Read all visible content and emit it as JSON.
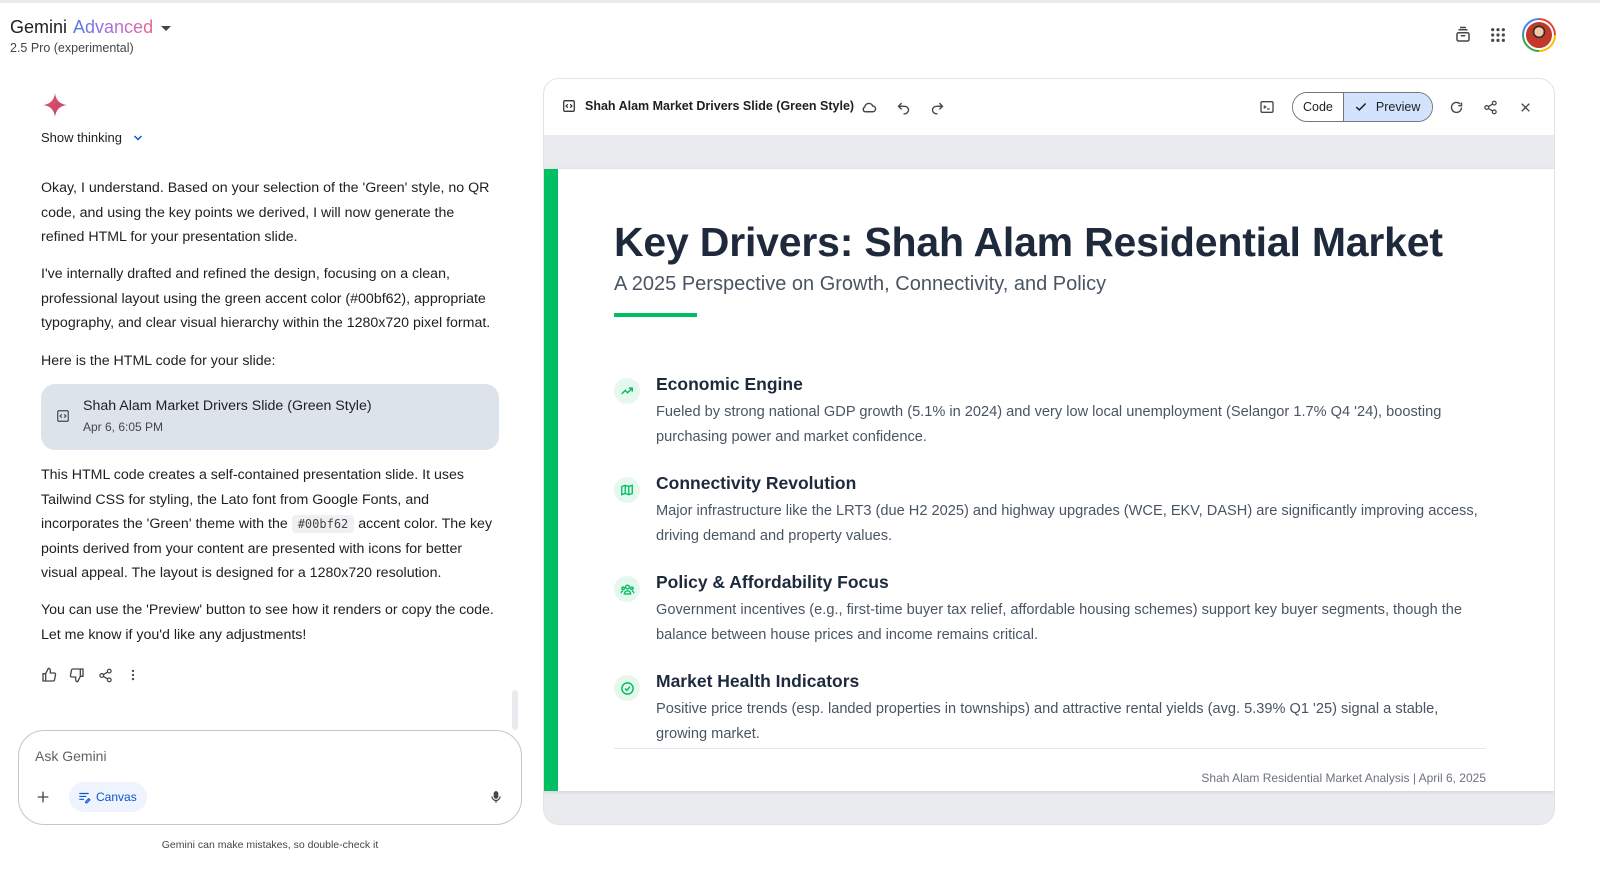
{
  "header": {
    "brand_name": "Gemini",
    "brand_tier": "Advanced",
    "model": "2.5 Pro (experimental)"
  },
  "chat": {
    "show_thinking": "Show thinking",
    "paragraphs": [
      "Okay, I understand. Based on your selection of the 'Green' style, no QR code, and using the key points we derived, I will now generate the refined HTML for your presentation slide.",
      "I've internally drafted and refined the design, focusing on a clean, professional layout using the green accent color (#00bf62), appropriate typography, and clear visual hierarchy within the 1280x720 pixel format.",
      "Here is the HTML code for your slide:"
    ],
    "artifact": {
      "title": "Shah Alam Market Drivers Slide (Green Style)",
      "date": "Apr 6, 6:05 PM"
    },
    "after_1_pre": "This HTML code creates a self-contained presentation slide. It uses Tailwind CSS for styling, the Lato font from Google Fonts, and incorporates the 'Green' theme with the",
    "after_1_code": "#00bf62",
    "after_1_post": "accent color. The key points derived from your content are presented with icons for better visual appeal. The layout is designed for a 1280x720 resolution.",
    "after_2": "You can use the 'Preview' button to see how it renders or copy the code. Let me know if you'd like any adjustments!",
    "input_placeholder": "Ask Gemini",
    "canvas_chip": "Canvas",
    "disclaimer": "Gemini can make mistakes, so double-check it"
  },
  "canvas": {
    "title": "Shah Alam Market Drivers Slide (Green Style)",
    "code_label": "Code",
    "preview_label": "Preview",
    "slide": {
      "accent_color": "#00bf62",
      "title": "Key Drivers: Shah Alam Residential Market",
      "subtitle": "A 2025 Perspective on Growth, Connectivity, and Policy",
      "points": [
        {
          "icon": "trending-up-icon",
          "title": "Economic Engine",
          "body": "Fueled by strong national GDP growth (5.1% in 2024) and very low local unemployment (Selangor 1.7% Q4 '24), boosting purchasing power and market confidence."
        },
        {
          "icon": "map-icon",
          "title": "Connectivity Revolution",
          "body": "Major infrastructure like the LRT3 (due H2 2025) and highway upgrades (WCE, EKV, DASH) are significantly improving access, driving demand and property values."
        },
        {
          "icon": "people-icon",
          "title": "Policy & Affordability Focus",
          "body": "Government incentives (e.g., first-time buyer tax relief, affordable housing schemes) support key buyer segments, though the balance between house prices and income remains critical."
        },
        {
          "icon": "check-circle-icon",
          "title": "Market Health Indicators",
          "body": "Positive price trends (esp. landed properties in townships) and attractive rental yields (avg. 5.39% Q1 '25) signal a stable, growing market."
        }
      ],
      "footer": "Shah Alam Residential Market Analysis | April 6, 2025"
    }
  }
}
